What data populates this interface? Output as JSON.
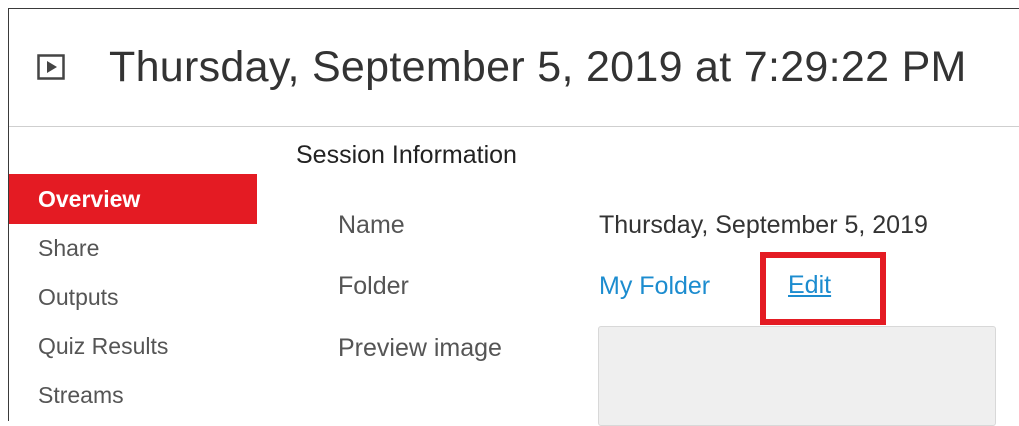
{
  "session": {
    "title": "Thursday, September 5, 2019 at 7:29:22 PM"
  },
  "section": {
    "title": "Session Information"
  },
  "nav": {
    "items": [
      {
        "label": "Overview",
        "active": true
      },
      {
        "label": "Share",
        "active": false
      },
      {
        "label": "Outputs",
        "active": false
      },
      {
        "label": "Quiz Results",
        "active": false
      },
      {
        "label": "Streams",
        "active": false
      }
    ]
  },
  "fields": {
    "name_label": "Name",
    "name_value": "Thursday, September 5, 2019",
    "folder_label": "Folder",
    "folder_value": "My Folder",
    "edit_label": "Edit",
    "preview_label": "Preview image"
  },
  "colors": {
    "accent": "#e41b23",
    "link": "#1c8ccf"
  },
  "icons": {
    "header": "play-icon"
  }
}
